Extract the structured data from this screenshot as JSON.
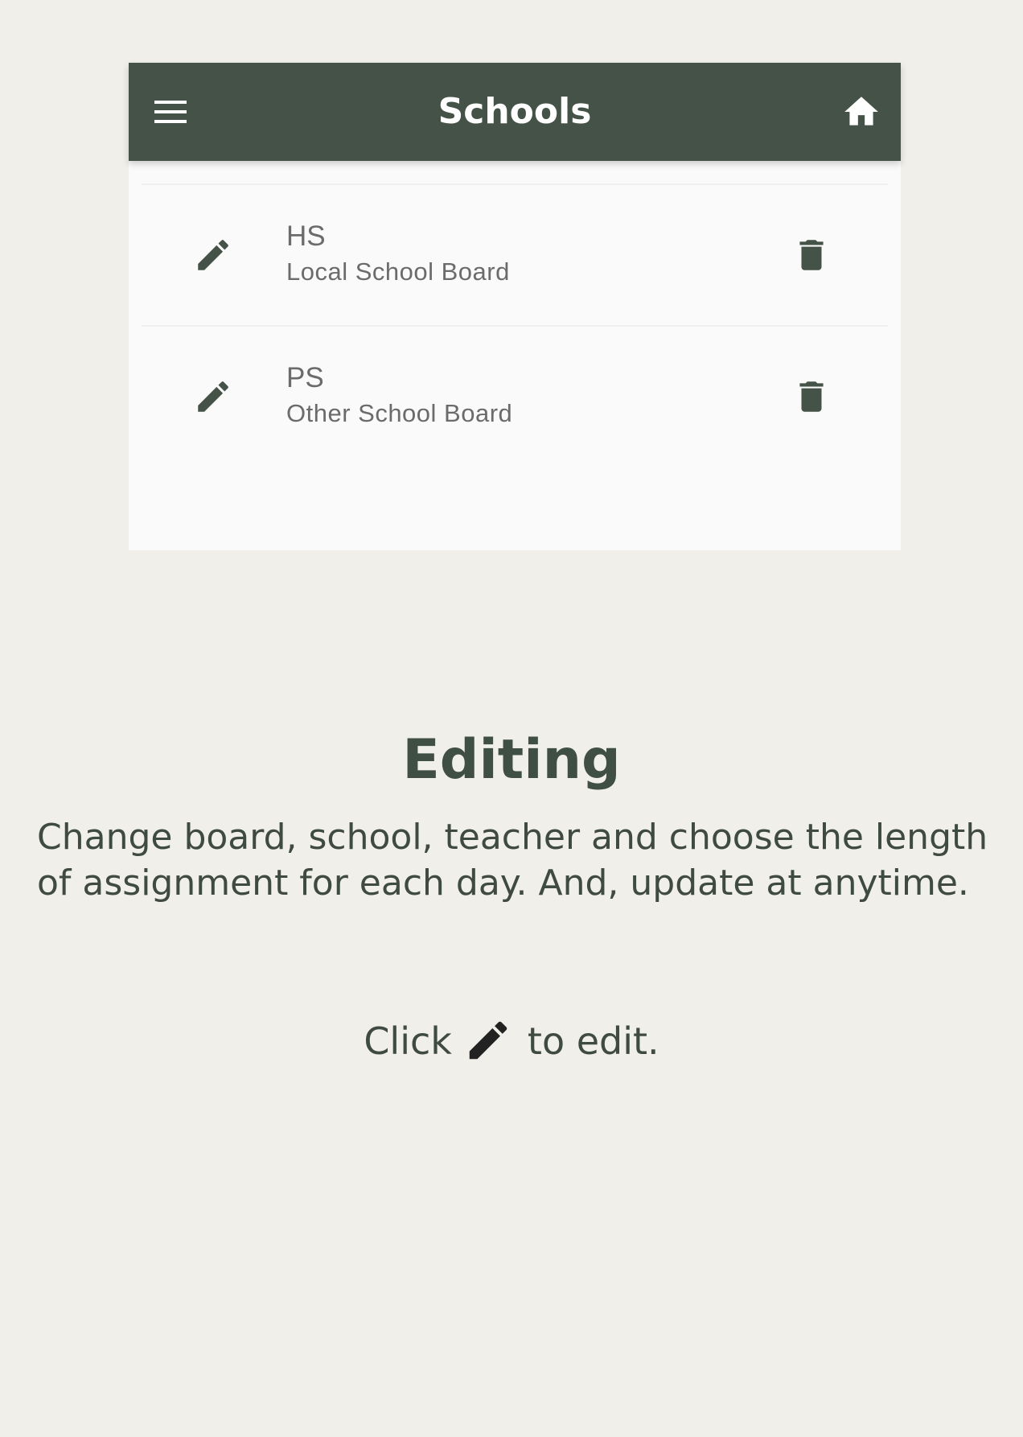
{
  "preview": {
    "appbar": {
      "title": "Schools",
      "menu_icon": "menu-icon",
      "home_icon": "home-icon"
    },
    "schools": [
      {
        "name": "HS",
        "board": "Local School Board",
        "edit_icon": "pencil-icon",
        "delete_icon": "trash-icon"
      },
      {
        "name": "PS",
        "board": "Other School Board",
        "edit_icon": "pencil-icon",
        "delete_icon": "trash-icon"
      }
    ]
  },
  "feature": {
    "heading": "Editing",
    "description": "Change board, school, teacher and choose the length of assignment for each day. And, update at anytime.",
    "hint_before": "Click",
    "hint_icon": "pencil-icon",
    "hint_after": "to edit."
  },
  "colors": {
    "background": "#f0efea",
    "appbar": "#445247",
    "accent_text": "#3f4f43",
    "icon": "#445247"
  }
}
